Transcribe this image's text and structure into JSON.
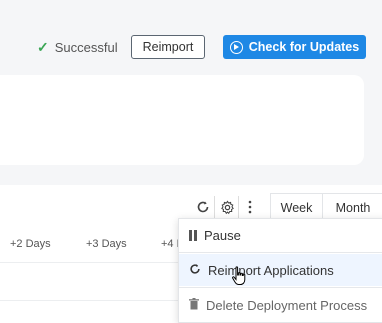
{
  "header": {
    "status_text": "Successful",
    "reimport_label": "Reimport",
    "check_updates_label": "Check for Updates"
  },
  "toolbar": {
    "icons": [
      "refresh-icon",
      "gear-icon",
      "more-vertical-icon"
    ],
    "view_options": [
      "Week",
      "Month"
    ]
  },
  "timeline": {
    "columns": [
      "+2 Days",
      "+3 Days",
      "+4 Days"
    ]
  },
  "menu": {
    "items": [
      {
        "label": "Pause",
        "icon": "pause-icon"
      },
      {
        "label": "Reimport Applications",
        "icon": "refresh-icon"
      },
      {
        "label": "Delete Deployment Process",
        "icon": "trash-icon"
      }
    ]
  },
  "colors": {
    "primary": "#1e88e5",
    "success": "#3aa655",
    "hover": "#eef5ff"
  }
}
